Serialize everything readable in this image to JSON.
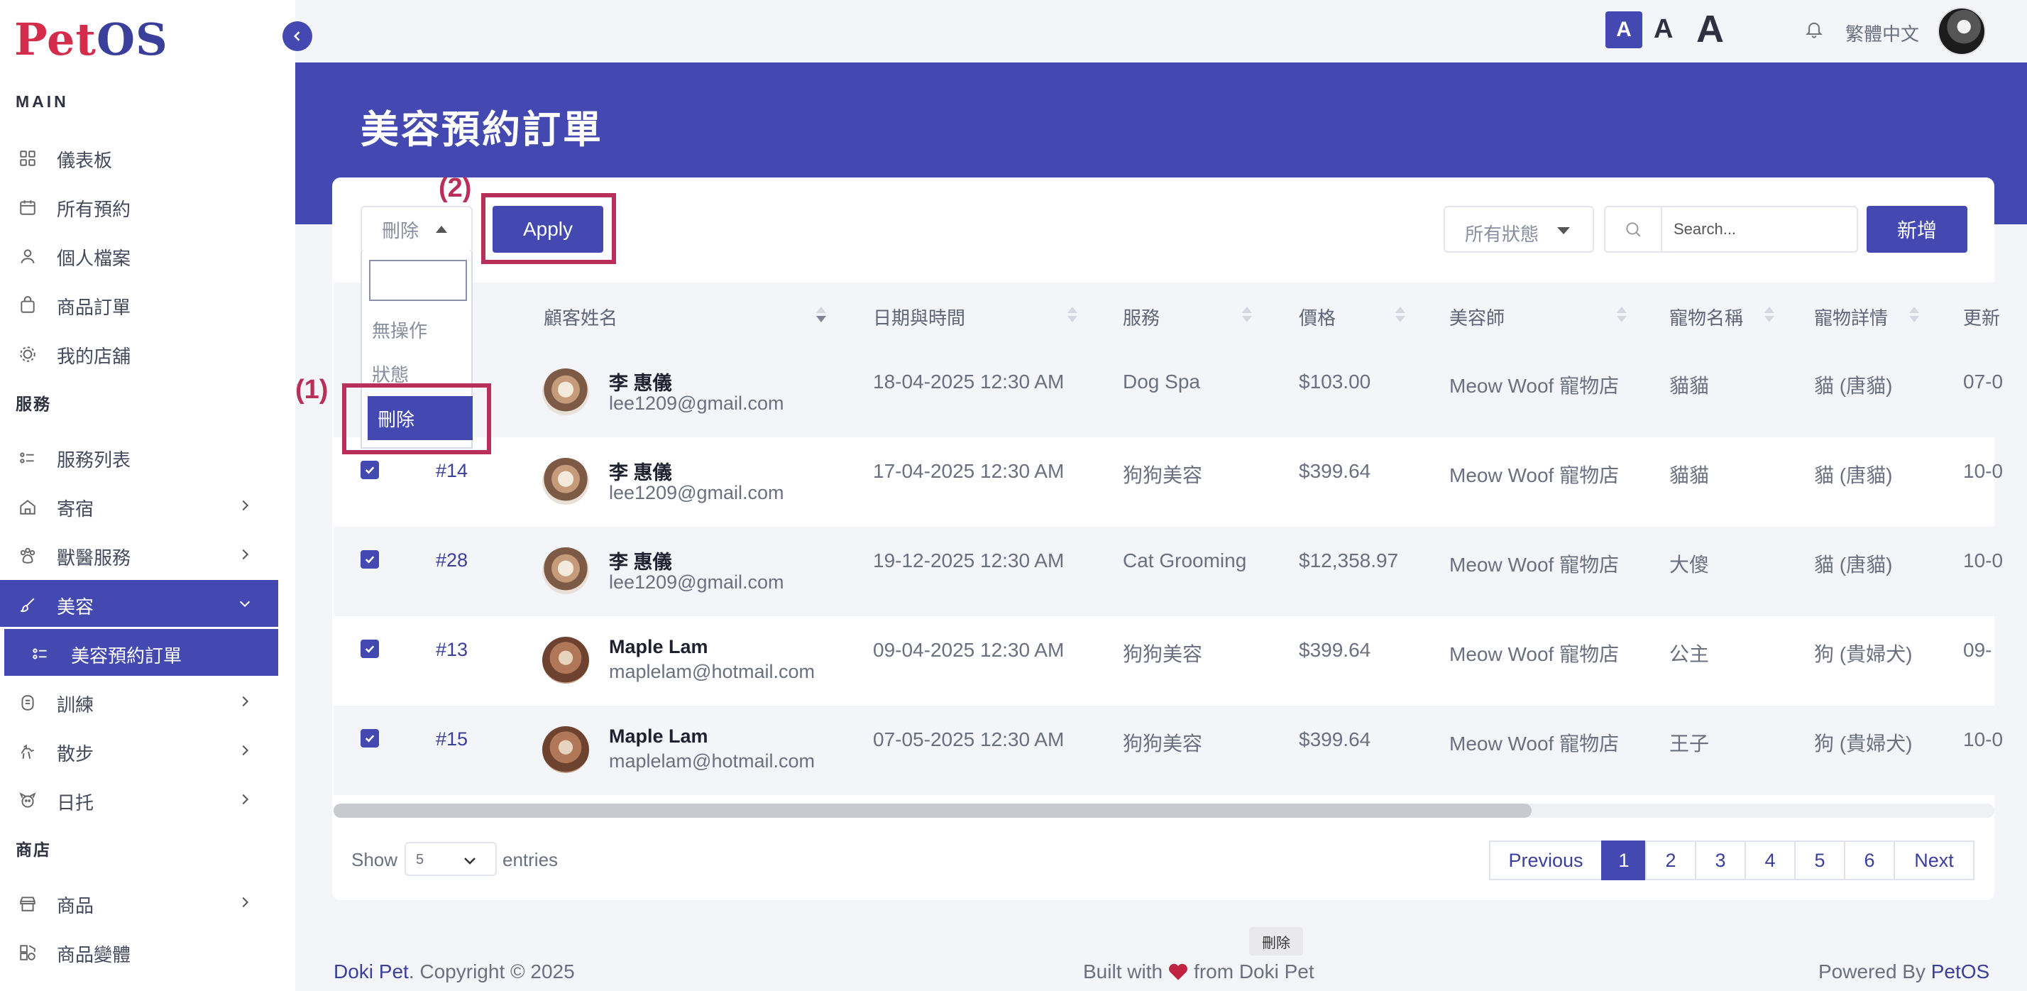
{
  "app": {
    "logo_part1": "Pet",
    "logo_part2": "OS"
  },
  "sidebar": {
    "sections": {
      "main": "MAIN",
      "services": "服務",
      "shop": "商店"
    },
    "items": [
      {
        "label": "儀表板",
        "icon": "grid-icon"
      },
      {
        "label": "所有預約",
        "icon": "calendar-icon"
      },
      {
        "label": "個人檔案",
        "icon": "user-icon"
      },
      {
        "label": "商品訂單",
        "icon": "shopping-bag-icon"
      },
      {
        "label": "我的店舖",
        "icon": "store-icon"
      },
      {
        "label": "服務列表",
        "icon": "list-icon"
      },
      {
        "label": "寄宿",
        "icon": "home-icon"
      },
      {
        "label": "獸醫服務",
        "icon": "vet-icon"
      },
      {
        "label": "美容",
        "icon": "brush-icon"
      },
      {
        "label": "美容預約訂單",
        "icon": "list-icon"
      },
      {
        "label": "訓練",
        "icon": "training-icon"
      },
      {
        "label": "散步",
        "icon": "walk-icon"
      },
      {
        "label": "日托",
        "icon": "daycare-icon"
      },
      {
        "label": "商品",
        "icon": "shop-icon"
      },
      {
        "label": "商品變體",
        "icon": "variants-icon"
      }
    ]
  },
  "topbar": {
    "font_small": "A",
    "font_medium": "A",
    "font_large": "A",
    "language": "繁體中文"
  },
  "page": {
    "title": "美容預約訂單"
  },
  "toolbar": {
    "bulk_action": "刪除",
    "apply": "Apply",
    "status_filter": "所有狀態",
    "search_placeholder": "Search...",
    "add": "新增",
    "dropdown_options": [
      "無操作",
      "狀態",
      "刪除"
    ],
    "annotation_1": "(1)",
    "annotation_2": "(2)"
  },
  "table": {
    "headers": [
      "顧客姓名",
      "日期與時間",
      "服務",
      "價格",
      "美容師",
      "寵物名稱",
      "寵物詳情",
      "更新"
    ],
    "rows": [
      {
        "id": "",
        "name": "李 惠儀",
        "email": "lee1209@gmail.com",
        "datetime": "18-04-2025 12:30 AM",
        "service": "Dog Spa",
        "price": "$103.00",
        "groomer": "Meow Woof 寵物店",
        "pet": "貓貓",
        "pet_detail": "貓 (唐貓)",
        "updated": "07-0",
        "checked": false
      },
      {
        "id": "#14",
        "name": "李 惠儀",
        "email": "lee1209@gmail.com",
        "datetime": "17-04-2025 12:30 AM",
        "service": "狗狗美容",
        "price": "$399.64",
        "groomer": "Meow Woof 寵物店",
        "pet": "貓貓",
        "pet_detail": "貓 (唐貓)",
        "updated": "10-0",
        "checked": true
      },
      {
        "id": "#28",
        "name": "李 惠儀",
        "email": "lee1209@gmail.com",
        "datetime": "19-12-2025 12:30 AM",
        "service": "Cat Grooming",
        "price": "$12,358.97",
        "groomer": "Meow Woof 寵物店",
        "pet": "大傻",
        "pet_detail": "貓 (唐貓)",
        "updated": "10-0",
        "checked": true
      },
      {
        "id": "#13",
        "name": "Maple Lam",
        "email": "maplelam@hotmail.com",
        "datetime": "09-04-2025 12:30 AM",
        "service": "狗狗美容",
        "price": "$399.64",
        "groomer": "Meow Woof 寵物店",
        "pet": "公主",
        "pet_detail": "狗 (貴婦犬)",
        "updated": "09-",
        "checked": true
      },
      {
        "id": "#15",
        "name": "Maple Lam",
        "email": "maplelam@hotmail.com",
        "datetime": "07-05-2025 12:30 AM",
        "service": "狗狗美容",
        "price": "$399.64",
        "groomer": "Meow Woof 寵物店",
        "pet": "王子",
        "pet_detail": "狗 (貴婦犬)",
        "updated": "10-0",
        "checked": true
      }
    ]
  },
  "pagination": {
    "show": "Show",
    "entries_value": "5",
    "entries": "entries",
    "previous": "Previous",
    "pages": [
      "1",
      "2",
      "3",
      "4",
      "5",
      "6"
    ],
    "next": "Next"
  },
  "tooltip": "刪除",
  "footer": {
    "left_brand": "Doki Pet",
    "left_rest": ". Copyright © 2025",
    "center_before": "Built with",
    "center_after": "from Doki Pet",
    "right_before": "Powered By",
    "right_brand": "PetOS"
  },
  "colors": {
    "primary": "#4349b0",
    "highlight": "#b8305a",
    "logo_red": "#d42c4b"
  }
}
